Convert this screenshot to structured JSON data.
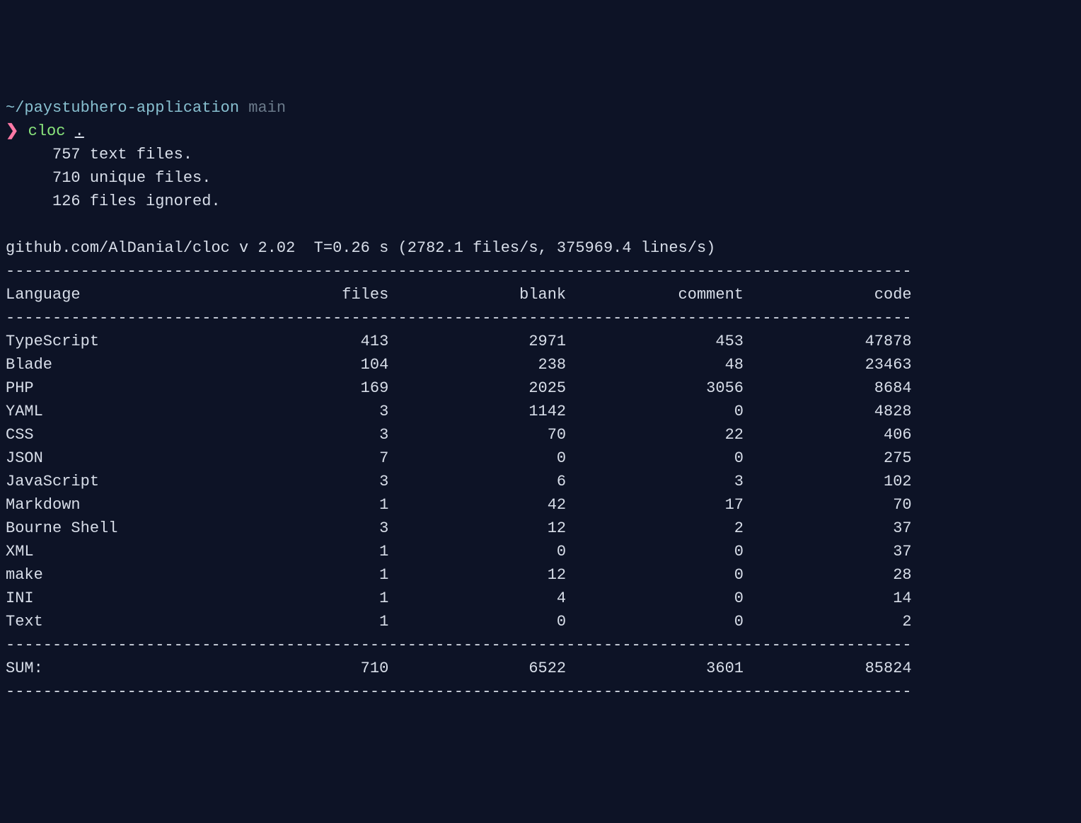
{
  "prompt": {
    "path": "~/paystubhero-application",
    "branch": "main",
    "symbol": "❯",
    "command_name": "cloc",
    "command_arg": "."
  },
  "summary": {
    "text_files": "     757 text files.",
    "unique_files": "     710 unique files.",
    "ignored": "     126 files ignored."
  },
  "meta_line": "github.com/AlDanial/cloc v 2.02  T=0.26 s (2782.1 files/s, 375969.4 lines/s)",
  "dash_line": "-------------------------------------------------------------------------------------------------",
  "header": {
    "language": "Language",
    "files": "files",
    "blank": "blank",
    "comment": "comment",
    "code": "code"
  },
  "rows": [
    {
      "language": "TypeScript",
      "files": "413",
      "blank": "2971",
      "comment": "453",
      "code": "47878"
    },
    {
      "language": "Blade",
      "files": "104",
      "blank": "238",
      "comment": "48",
      "code": "23463"
    },
    {
      "language": "PHP",
      "files": "169",
      "blank": "2025",
      "comment": "3056",
      "code": "8684"
    },
    {
      "language": "YAML",
      "files": "3",
      "blank": "1142",
      "comment": "0",
      "code": "4828"
    },
    {
      "language": "CSS",
      "files": "3",
      "blank": "70",
      "comment": "22",
      "code": "406"
    },
    {
      "language": "JSON",
      "files": "7",
      "blank": "0",
      "comment": "0",
      "code": "275"
    },
    {
      "language": "JavaScript",
      "files": "3",
      "blank": "6",
      "comment": "3",
      "code": "102"
    },
    {
      "language": "Markdown",
      "files": "1",
      "blank": "42",
      "comment": "17",
      "code": "70"
    },
    {
      "language": "Bourne Shell",
      "files": "3",
      "blank": "12",
      "comment": "2",
      "code": "37"
    },
    {
      "language": "XML",
      "files": "1",
      "blank": "0",
      "comment": "0",
      "code": "37"
    },
    {
      "language": "make",
      "files": "1",
      "blank": "12",
      "comment": "0",
      "code": "28"
    },
    {
      "language": "INI",
      "files": "1",
      "blank": "4",
      "comment": "0",
      "code": "14"
    },
    {
      "language": "Text",
      "files": "1",
      "blank": "0",
      "comment": "0",
      "code": "2"
    }
  ],
  "sum": {
    "label": "SUM:",
    "files": "710",
    "blank": "6522",
    "comment": "3601",
    "code": "85824"
  },
  "chart_data": {
    "type": "table",
    "title": "cloc output by Language",
    "columns": [
      "Language",
      "files",
      "blank",
      "comment",
      "code"
    ],
    "rows": [
      [
        "TypeScript",
        413,
        2971,
        453,
        47878
      ],
      [
        "Blade",
        104,
        238,
        48,
        23463
      ],
      [
        "PHP",
        169,
        2025,
        3056,
        8684
      ],
      [
        "YAML",
        3,
        1142,
        0,
        4828
      ],
      [
        "CSS",
        3,
        70,
        22,
        406
      ],
      [
        "JSON",
        7,
        0,
        0,
        275
      ],
      [
        "JavaScript",
        3,
        6,
        3,
        102
      ],
      [
        "Markdown",
        1,
        42,
        17,
        70
      ],
      [
        "Bourne Shell",
        3,
        12,
        2,
        37
      ],
      [
        "XML",
        1,
        0,
        0,
        37
      ],
      [
        "make",
        1,
        12,
        0,
        28
      ],
      [
        "INI",
        1,
        4,
        0,
        14
      ],
      [
        "Text",
        1,
        0,
        0,
        2
      ]
    ],
    "sum": [
      "SUM:",
      710,
      6522,
      3601,
      85824
    ]
  },
  "col_widths": {
    "language": 26,
    "files": 15,
    "blank": 19,
    "comment": 19,
    "code": 18
  }
}
